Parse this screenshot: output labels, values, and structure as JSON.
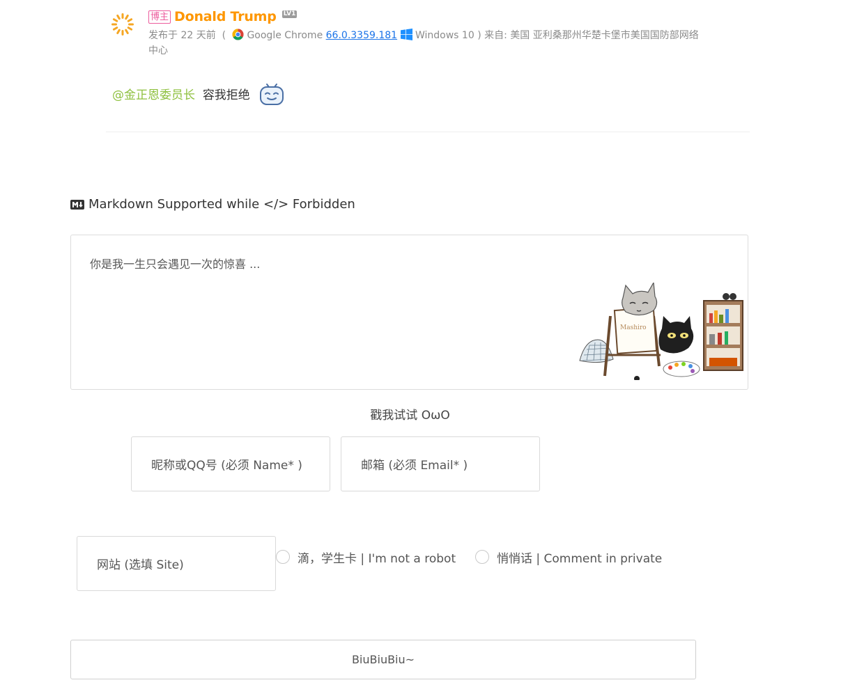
{
  "comment": {
    "owner_badge": "博主",
    "author": "Donald Trump",
    "level": "LV1",
    "posted_prefix": "发布于",
    "posted_time": "22 天前",
    "browser": "Google Chrome",
    "browser_version": "66.0.3359.181",
    "os": "Windows 10",
    "location_prefix": "来自:",
    "location": "美国 亚利桑那州华楚卡堡市美国国防部网络中心",
    "mention": "@金正恩委员长",
    "text": "容我拒绝"
  },
  "form": {
    "markdown_notice": "Markdown Supported while </> Forbidden",
    "textarea_placeholder": "你是我一生只会遇见一次的惊喜 ...",
    "mascot_text": "Mashiro",
    "owo_label": "戳我试试 OωO",
    "name_placeholder": "昵称或QQ号 (必须 Name* )",
    "email_placeholder": "邮箱 (必须 Email* )",
    "site_placeholder": "网站 (选填 Site)",
    "robot_label": "滴，学生卡 | I'm not a robot",
    "private_label": "悄悄话 | Comment in private",
    "submit_label": "BiuBiuBiu~"
  },
  "colors": {
    "author": "#fe9600",
    "owner_badge": "#ec5b9c",
    "mention": "#8ec03e",
    "link": "#1a73e8"
  }
}
